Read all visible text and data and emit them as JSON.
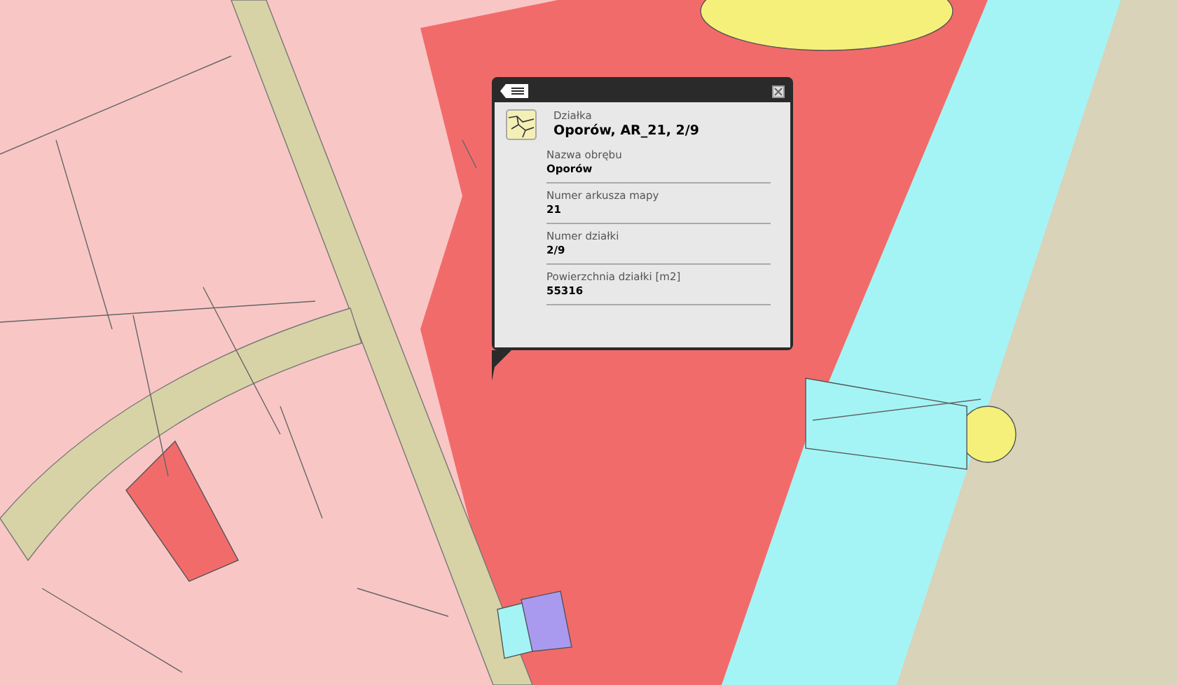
{
  "popup": {
    "category": "Działka",
    "title": "Oporów, AR_21, 2/9",
    "fields": [
      {
        "label": "Nazwa obrębu",
        "value": "Oporów"
      },
      {
        "label": "Numer arkusza mapy",
        "value": "21"
      },
      {
        "label": "Numer działki",
        "value": "2/9"
      },
      {
        "label": "Powierzchnia działki [m2]",
        "value": "55316"
      }
    ]
  }
}
